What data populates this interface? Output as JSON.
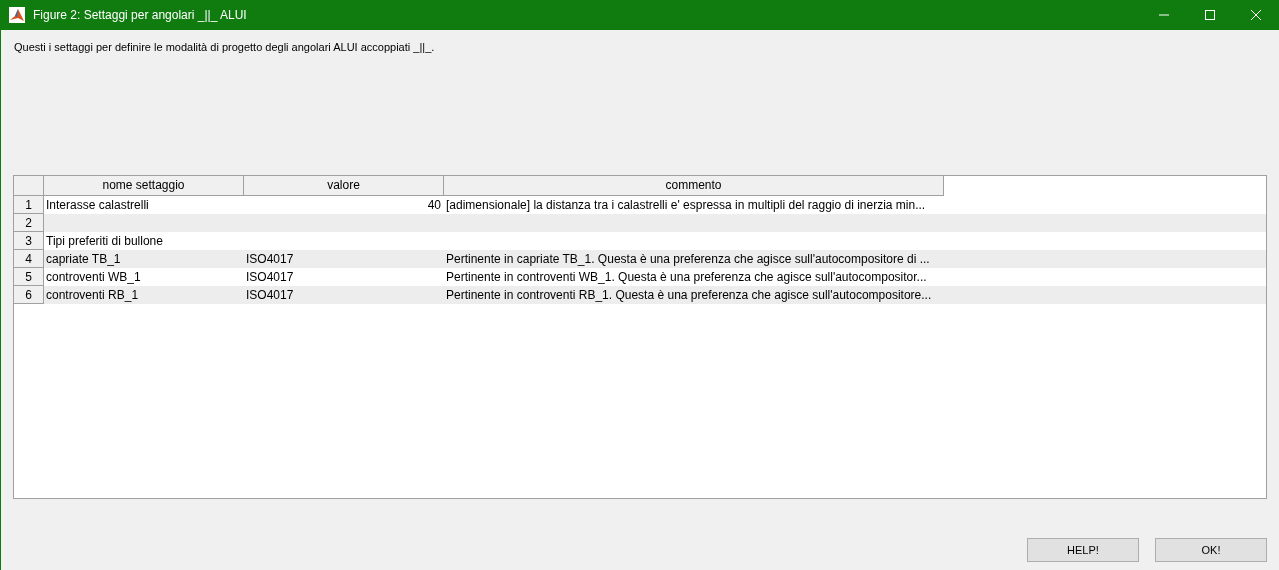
{
  "window": {
    "title": "Figure 2: Settaggi per angolari _||_ ALUI"
  },
  "description": "Questi i settaggi per definire le modalità di progetto degli angolari ALUI accoppiati _||_.",
  "table": {
    "columns": [
      "nome settaggio",
      "valore",
      "commento"
    ],
    "rows": [
      {
        "index": "1",
        "name": "Interasse calastrelli",
        "value": "40",
        "numeric": true,
        "comment": "[adimensionale] la distanza tra i calastrelli e' espressa in multipli del raggio di inerzia min..."
      },
      {
        "index": "2"
      },
      {
        "index": "3",
        "name": "Tipi preferiti di bullone"
      },
      {
        "index": "4",
        "name": "capriate TB_1",
        "value": "ISO4017",
        "numeric": false,
        "comment": "Pertinente in capriate TB_1. Questa è una preferenza che agisce sull'autocompositore di ..."
      },
      {
        "index": "5",
        "name": "controventi WB_1",
        "value": "ISO4017",
        "numeric": false,
        "comment": "Pertinente in controventi WB_1. Questa è una preferenza che agisce sull'autocompositor..."
      },
      {
        "index": "6",
        "name": "controventi RB_1",
        "value": "ISO4017",
        "numeric": false,
        "comment": "Pertinente in controventi RB_1. Questa è una preferenza che agisce sull'autocompositore..."
      }
    ]
  },
  "buttons": [
    "HELP!",
    "OK!"
  ]
}
